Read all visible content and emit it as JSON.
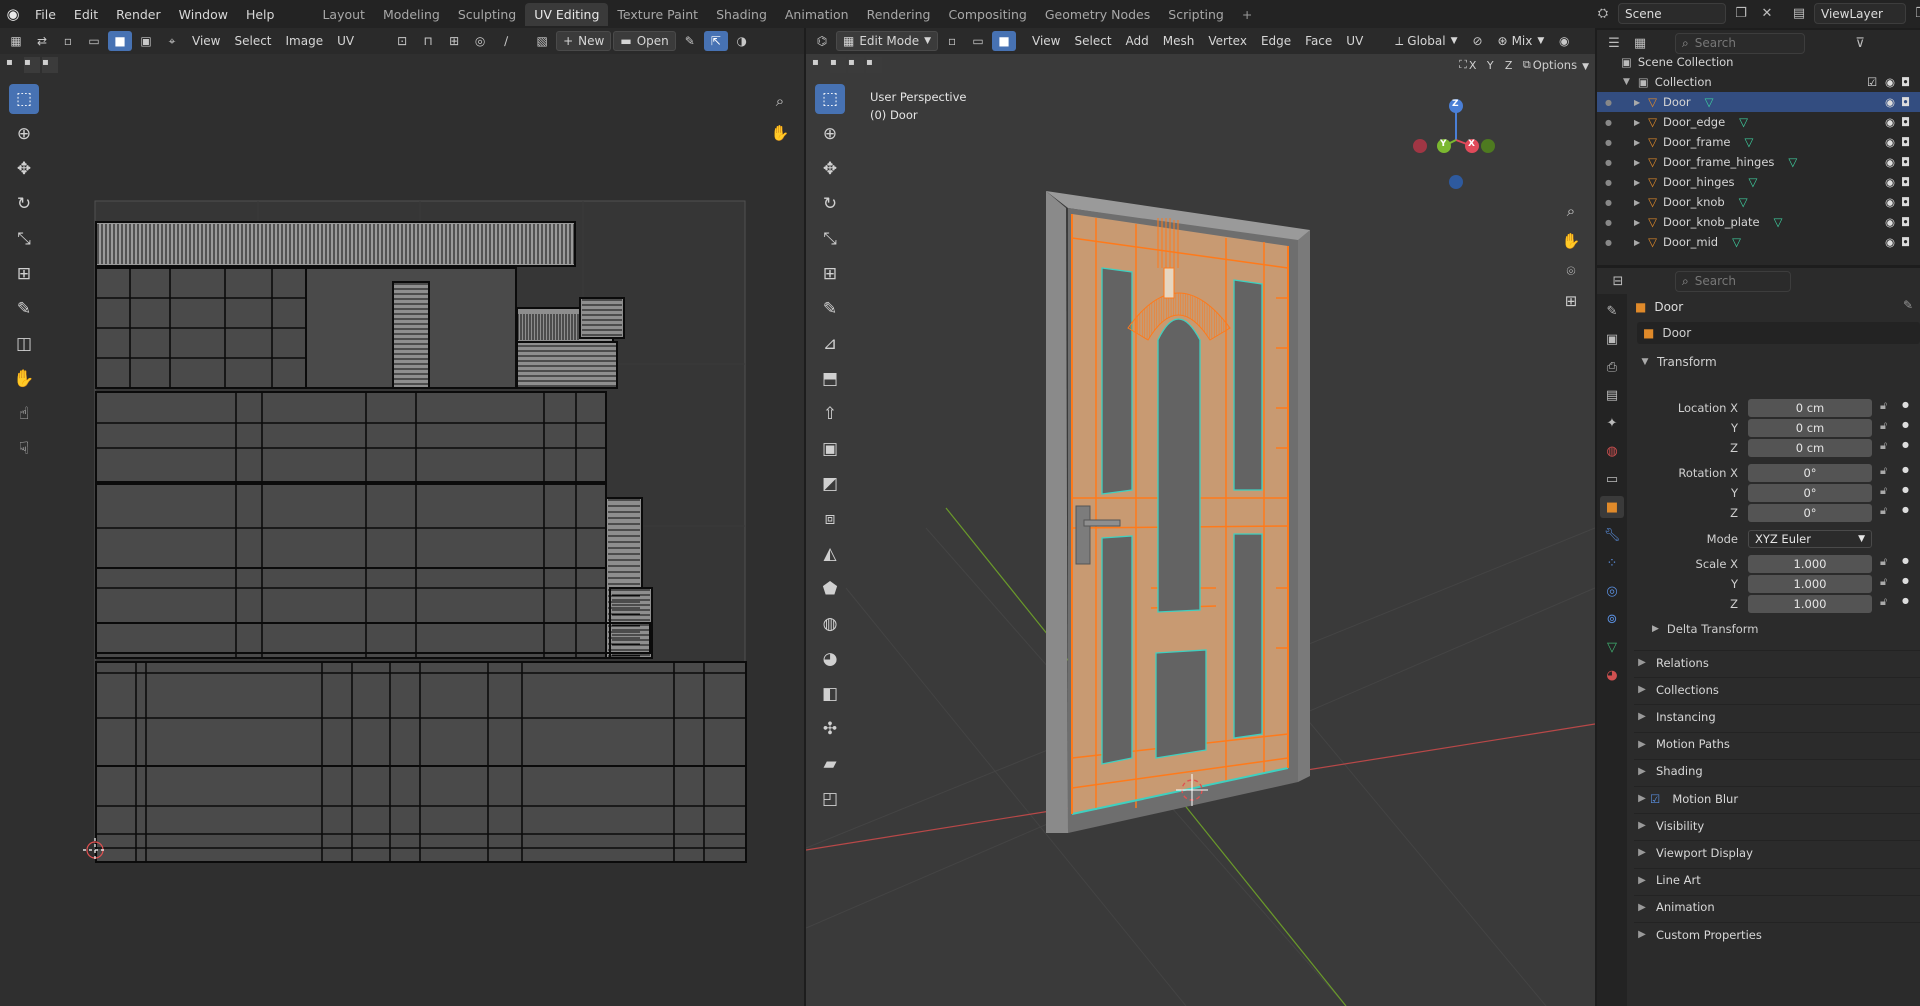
{
  "menu": [
    "File",
    "Edit",
    "Render",
    "Window",
    "Help"
  ],
  "workspaces": [
    "Layout",
    "Modeling",
    "Sculpting",
    "UV Editing",
    "Texture Paint",
    "Shading",
    "Animation",
    "Rendering",
    "Compositing",
    "Geometry Nodes",
    "Scripting"
  ],
  "active_workspace": "UV Editing",
  "scene_label": "Scene",
  "viewlayer_label": "ViewLayer",
  "uv_editor": {
    "menus": [
      "View",
      "Select",
      "Image",
      "UV"
    ],
    "new_label": "New",
    "open_label": "Open"
  },
  "viewport": {
    "mode": "Edit Mode",
    "menus": [
      "View",
      "Select",
      "Add",
      "Mesh",
      "Vertex",
      "Edge",
      "Face",
      "UV"
    ],
    "orientation": "Global",
    "mix": "Mix",
    "axes": [
      "X",
      "Y",
      "Z"
    ],
    "options_label": "Options",
    "overlay_title": "User Perspective",
    "overlay_object": "(0) Door",
    "gizmo": {
      "x": "X",
      "y": "Y",
      "z": "Z"
    }
  },
  "outliner": {
    "search_placeholder": "Search",
    "scene_collection": "Scene Collection",
    "collection": "Collection",
    "objects": [
      "Door",
      "Door_edge",
      "Door_frame",
      "Door_frame_hinges",
      "Door_hinges",
      "Door_knob",
      "Door_knob_plate",
      "Door_mid"
    ],
    "active": "Door"
  },
  "properties": {
    "search_placeholder": "Search",
    "object_name": "Door",
    "data_name": "Door",
    "transform_title": "Transform",
    "location_label": "Location X",
    "rotation_label": "Rotation X",
    "scale_label": "Scale X",
    "y_label": "Y",
    "z_label": "Z",
    "location": [
      "0 cm",
      "0 cm",
      "0 cm"
    ],
    "rotation": [
      "0°",
      "0°",
      "0°"
    ],
    "mode_label": "Mode",
    "mode_value": "XYZ Euler",
    "scale": [
      "1.000",
      "1.000",
      "1.000"
    ],
    "delta_transform": "Delta Transform",
    "panels": [
      "Relations",
      "Collections",
      "Instancing",
      "Motion Paths",
      "Shading",
      "Motion Blur",
      "Visibility",
      "Viewport Display",
      "Line Art",
      "Animation",
      "Custom Properties"
    ]
  },
  "colors": {
    "accent": "#4772b3",
    "selected_edges": "#ff7a1a",
    "seam": "#3fd0c0",
    "face_fill": "#c89a72"
  }
}
